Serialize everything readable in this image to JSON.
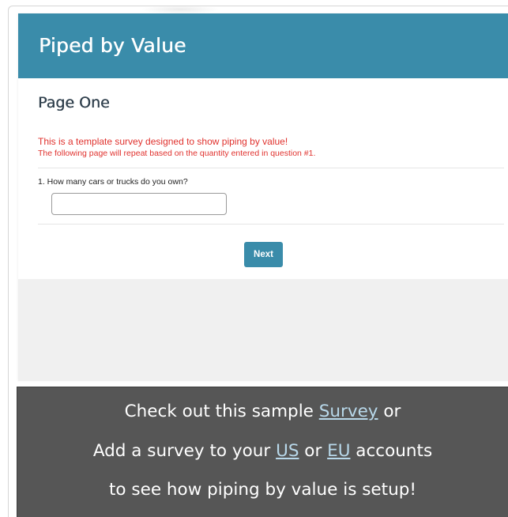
{
  "survey": {
    "title": "Piped by Value",
    "page_title": "Page One",
    "intro_line1": "This is a template survey designed to show piping by value!",
    "intro_line2": "The following page will repeat based on the quantity entered in question #1.",
    "question": {
      "label": "1. How many cars or trucks do you own?",
      "value": "",
      "placeholder": ""
    },
    "next_label": "Next"
  },
  "info": {
    "line1_prefix": "Check out this sample ",
    "line1_link": "Survey",
    "line1_suffix": " or",
    "line2_prefix": "Add a survey to your ",
    "line2_link_us": "US",
    "line2_middle": " or ",
    "line2_link_eu": "EU",
    "line2_suffix": " accounts",
    "line3": "to see how piping by value is setup!"
  },
  "colors": {
    "accent": "#3a8caa",
    "intro_text": "#e0322e",
    "panel_bg": "#565656",
    "link": "#b8d8ea"
  }
}
